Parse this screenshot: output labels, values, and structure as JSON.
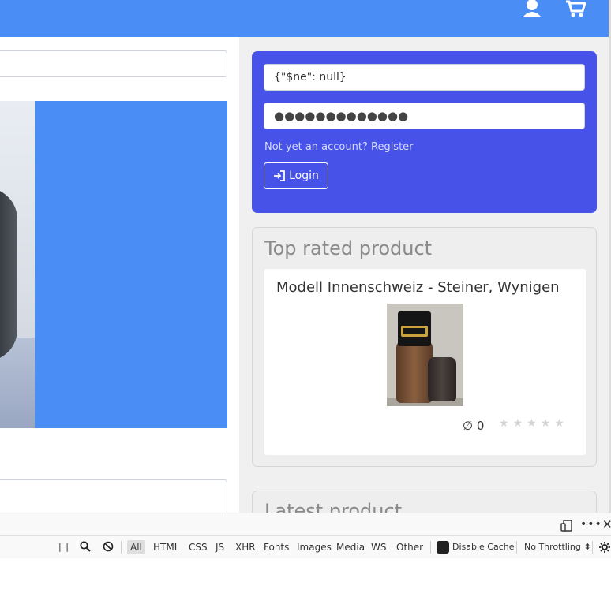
{
  "header": {
    "icons": [
      "user-icon",
      "cart-icon"
    ],
    "accent": "#4a8ef5"
  },
  "sidebar": {
    "login": {
      "username_value": "{\"$ne\": null}",
      "password_value": "●●●●●●●●●●●●●",
      "register_text": "Not yet an account? Register",
      "login_label": "Login",
      "card_color": "#4753e8"
    },
    "top_rated": {
      "title": "Top rated product",
      "product_name": "Modell Innenschweiz - Steiner, Wynigen",
      "rating_avg": "∅ 0",
      "stars": 5,
      "stars_filled": 0
    },
    "latest": {
      "title": "Latest product"
    }
  },
  "devtools": {
    "filters": [
      "All",
      "HTML",
      "CSS",
      "JS",
      "XHR",
      "Fonts",
      "Images",
      "Media",
      "WS",
      "Other"
    ],
    "active_filter": "All",
    "disable_cache_label": "Disable Cache",
    "throttling_label": "No Throttling ⬍"
  }
}
